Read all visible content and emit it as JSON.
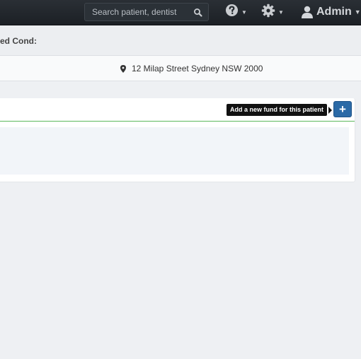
{
  "navbar": {
    "search_placeholder": "Search patient, dentist",
    "icons": [
      "question-circle-icon",
      "gear-icon",
      "user-icon",
      "search-icon"
    ],
    "user_label": "Admin"
  },
  "info": {
    "cond_label": "ed Cond:",
    "address": "12 Milap Street Sydney NSW 2000"
  },
  "funds_panel": {
    "add_tooltip": "Add a new fund for this patient",
    "add_button_label": "+",
    "accent_colors": {
      "button": "#2b6aa6",
      "divider": "#5cb85c"
    }
  }
}
